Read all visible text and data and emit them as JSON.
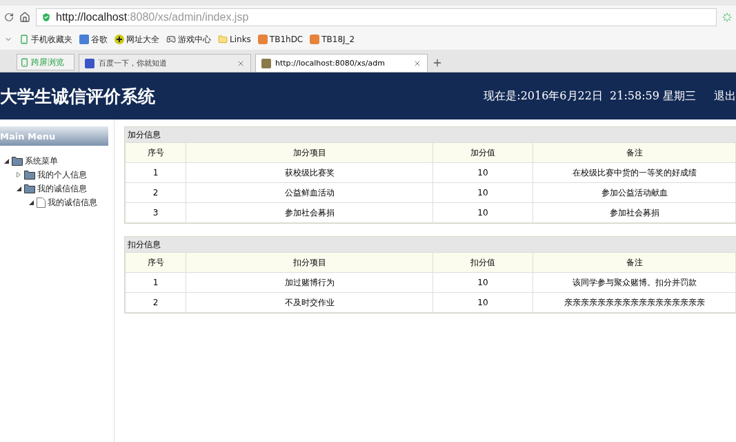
{
  "browser": {
    "url_host": "http://localhost",
    "url_rest": ":8080/xs/admin/index.jsp",
    "bookmarks": [
      {
        "label": "手机收藏夹",
        "kind": "phone"
      },
      {
        "label": "谷歌",
        "kind": "google"
      },
      {
        "label": "网址大全",
        "kind": "plus"
      },
      {
        "label": "游戏中心",
        "kind": "game"
      },
      {
        "label": "Links",
        "kind": "folder"
      },
      {
        "label": "TB1hDC",
        "kind": "taobao"
      },
      {
        "label": "TB18J_2",
        "kind": "taobao"
      }
    ],
    "side_tab": "跨屏浏览",
    "tabs": [
      {
        "label": "百度一下，你就知道",
        "selected": false
      },
      {
        "label": "http://localhost:8080/xs/adm",
        "selected": true
      }
    ]
  },
  "header": {
    "title": "大学生诚信评价系统",
    "datetime": "现在是:2016年6月22日  21:58:59 星期三",
    "logout": "退出"
  },
  "sidebar": {
    "title": "Main Menu",
    "tree": [
      {
        "label": "系统菜单",
        "kind": "folder",
        "expanded": true,
        "children": [
          {
            "label": "我的个人信息",
            "kind": "folder",
            "expanded": false
          },
          {
            "label": "我的诚信信息",
            "kind": "folder",
            "expanded": true,
            "children": [
              {
                "label": "我的诚信信息",
                "kind": "file",
                "expanded": true
              }
            ]
          }
        ]
      }
    ]
  },
  "sections": [
    {
      "title": "加分信息",
      "columns": [
        "序号",
        "加分项目",
        "加分值",
        "备注"
      ],
      "rows": [
        [
          "1",
          "获校级比赛奖",
          "10",
          "在校级比赛中货的一等奖的好成绩"
        ],
        [
          "2",
          "公益鲜血活动",
          "10",
          "参加公益活动献血"
        ],
        [
          "3",
          "参加社会募捐",
          "10",
          "参加社会募捐"
        ]
      ]
    },
    {
      "title": "扣分信息",
      "columns": [
        "序号",
        "扣分项目",
        "扣分值",
        "备注"
      ],
      "rows": [
        [
          "1",
          "加过赌博行为",
          "10",
          "该同学参与聚众赌博。扣分并罚款"
        ],
        [
          "2",
          "不及时交作业",
          "10",
          "亲亲亲亲亲亲亲亲亲亲亲亲亲亲亲亲亲"
        ]
      ]
    }
  ]
}
